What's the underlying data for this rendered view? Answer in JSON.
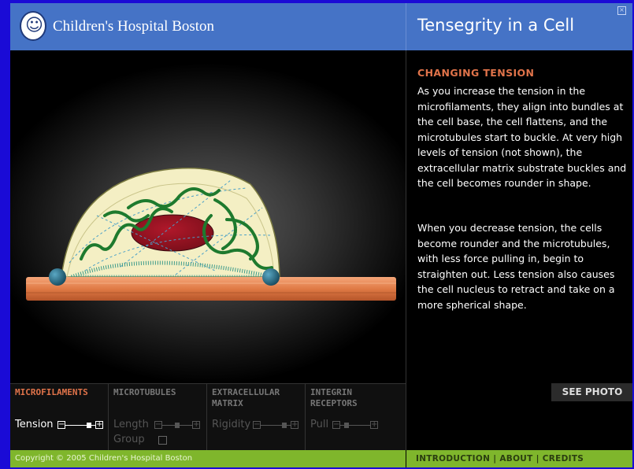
{
  "header": {
    "brand": "Children's Hospital Boston",
    "logo_icon": "mother-child-logo",
    "title": "Tensegrity in a Cell",
    "close_icon": "close-icon"
  },
  "article": {
    "heading": "CHANGING TENSION",
    "paragraph1": "As you increase the tension in the microfilaments, they align into bundles at the cell base, the cell flattens, and the microtubules start to buckle. At very high levels of tension (not shown), the extracellular matrix substrate buckles and the cell becomes rounder in shape.",
    "paragraph2": "When you decrease tension, the cells become rounder and the microtubules, with less force pulling in, begin to straighten out. Less tension also causes the cell nucleus to retract and take on a more spherical shape.",
    "see_photo": "SEE PHOTO"
  },
  "controls": {
    "tabs": [
      {
        "label": "MICROFILAMENTS",
        "active": true,
        "slider_label": "Tension",
        "value": 0.85
      },
      {
        "label": "MICROTUBULES",
        "active": false,
        "slider_label": "Length",
        "value": 0.5,
        "checkbox_label": "Group"
      },
      {
        "label": "EXTRACELLULAR MATRIX",
        "active": false,
        "slider_label": "Rigidity",
        "value": 0.85
      },
      {
        "label": "INTEGRIN RECEPTORS",
        "active": false,
        "slider_label": "Pull",
        "value": 0.15
      }
    ]
  },
  "footer": {
    "copyright": "Copyright © 2005 Children's Hospital Boston",
    "nav": [
      "INTRODUCTION",
      "ABOUT",
      "CREDITS"
    ]
  },
  "colors": {
    "header_blue": "#4573c6",
    "accent_orange": "#e0734a",
    "footer_green": "#7fb62c",
    "page_border": "#1a0bd6"
  }
}
